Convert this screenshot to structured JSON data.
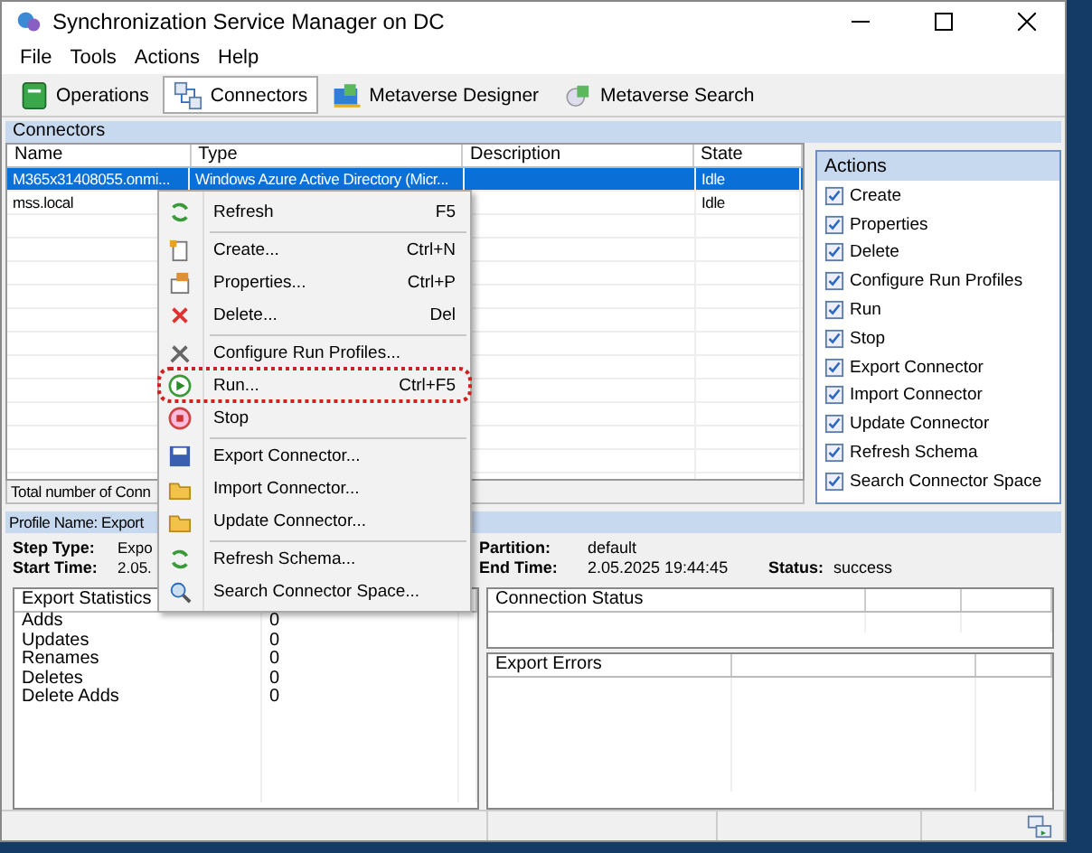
{
  "window": {
    "title": "Synchronization Service Manager on DC"
  },
  "menu_bar": [
    "File",
    "Tools",
    "Actions",
    "Help"
  ],
  "toolbar": [
    {
      "label": "Operations",
      "selected": false
    },
    {
      "label": "Connectors",
      "selected": true
    },
    {
      "label": "Metaverse Designer",
      "selected": false
    },
    {
      "label": "Metaverse Search",
      "selected": false
    }
  ],
  "connectors": {
    "title": "Connectors",
    "columns": [
      "Name",
      "Type",
      "Description",
      "State"
    ],
    "rows": [
      {
        "name": "M365x31408055.onmi...",
        "type": "Windows Azure Active Directory (Micr...",
        "state": "Idle",
        "selected": true
      },
      {
        "name": "mss.local",
        "state": "Idle",
        "selected": false
      }
    ],
    "total": "Total number of Conn"
  },
  "actions": {
    "title": "Actions",
    "items": [
      "Create",
      "Properties",
      "Delete",
      "Configure Run Profiles",
      "Run",
      "Stop",
      "Export Connector",
      "Import Connector",
      "Update Connector",
      "Refresh Schema",
      "Search Connector Space"
    ]
  },
  "context_menu": [
    {
      "label": "Refresh",
      "shortcut": "F5",
      "separator_after": true,
      "highlighted": false
    },
    {
      "label": "Create...",
      "shortcut": "Ctrl+N",
      "separator_after": false,
      "highlighted": false
    },
    {
      "label": "Properties...",
      "shortcut": "Ctrl+P",
      "separator_after": false,
      "highlighted": false
    },
    {
      "label": "Delete...",
      "shortcut": "Del",
      "separator_after": true,
      "highlighted": false
    },
    {
      "label": "Configure Run Profiles...",
      "separator_after": false,
      "highlighted": false
    },
    {
      "label": "Run...",
      "shortcut": "Ctrl+F5",
      "separator_after": false,
      "highlighted": true
    },
    {
      "label": "Stop",
      "separator_after": true,
      "highlighted": false
    },
    {
      "label": "Export Connector...",
      "separator_after": false,
      "highlighted": false
    },
    {
      "label": "Import Connector...",
      "separator_after": false,
      "highlighted": false
    },
    {
      "label": "Update Connector...",
      "separator_after": true,
      "highlighted": false
    },
    {
      "label": "Refresh Schema...",
      "separator_after": false,
      "highlighted": false
    },
    {
      "label": "Search Connector Space...",
      "separator_after": false,
      "highlighted": false
    }
  ],
  "profile": {
    "title": "Profile Name: Export",
    "step_type_label": "Step Type:",
    "step_type": "Expo",
    "start_time_label": "Start Time:",
    "start_time": "2.05.",
    "partition_label": "Partition:",
    "partition": "default",
    "end_time_label": "End Time:",
    "end_time": "2.05.2025 19:44:45",
    "status_label": "Status:",
    "status": "success"
  },
  "export_statistics": {
    "title": "Export Statistics",
    "rows": [
      {
        "label": "Adds",
        "value": "0"
      },
      {
        "label": "Updates",
        "value": "0"
      },
      {
        "label": "Renames",
        "value": "0"
      },
      {
        "label": "Deletes",
        "value": "0"
      },
      {
        "label": "Delete Adds",
        "value": "0"
      }
    ]
  },
  "connection_status": {
    "title": "Connection Status"
  },
  "export_errors": {
    "title": "Export Errors"
  }
}
